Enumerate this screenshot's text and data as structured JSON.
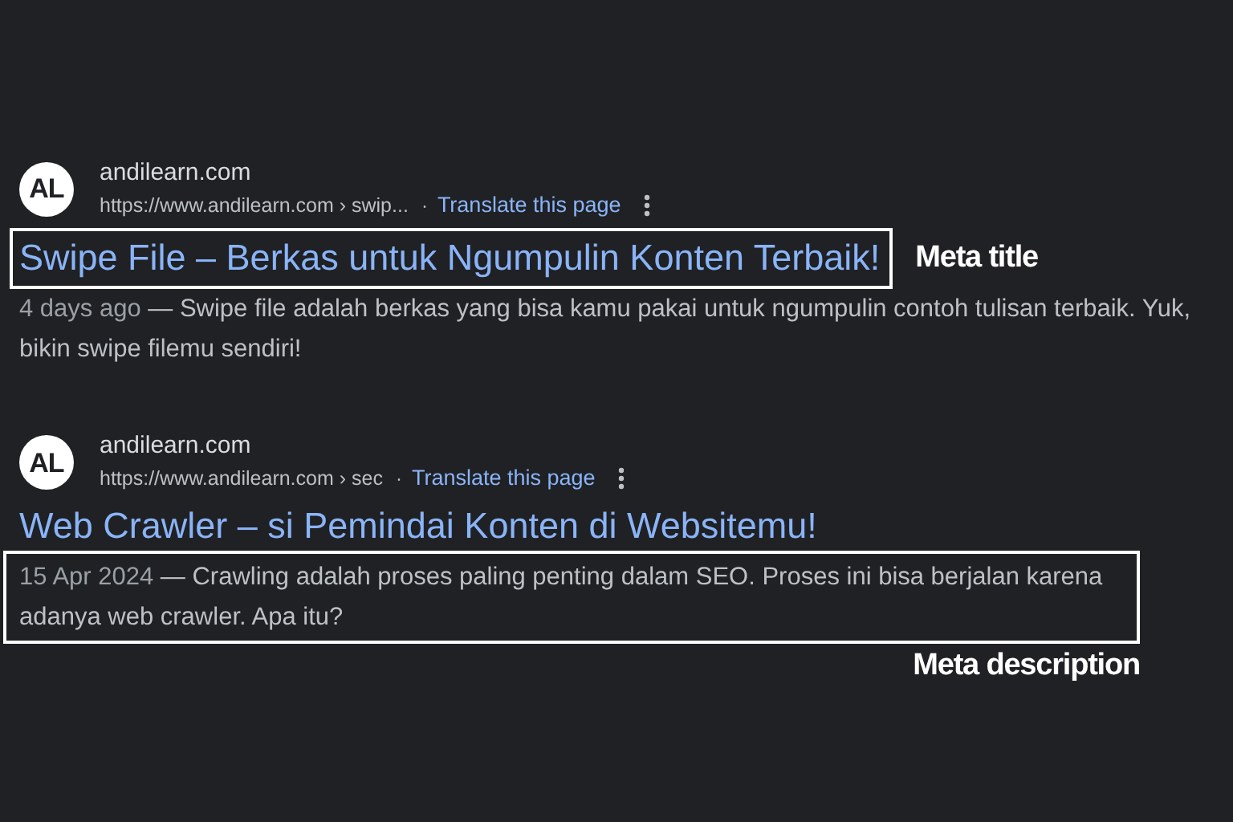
{
  "results": [
    {
      "favicon": "AL",
      "site": "andilearn.com",
      "url": "https://www.andilearn.com › swip...",
      "separator": "·",
      "translate": "Translate this page",
      "title": "Swipe File – Berkas untuk Ngumpulin Konten Terbaik!",
      "date": "4 days ago",
      "snippet": " — Swipe file adalah berkas yang bisa kamu pakai untuk ngumpulin contoh tulisan terbaik. Yuk, bikin swipe filemu sendiri!",
      "annotation": {
        "kind": "title",
        "label": "Meta title"
      }
    },
    {
      "favicon": "AL",
      "site": "andilearn.com",
      "url": "https://www.andilearn.com › sec",
      "separator": "·",
      "translate": "Translate this page",
      "title": "Web Crawler – si Pemindai Konten di Websitemu!",
      "date": "15 Apr 2024",
      "snippet": " — Crawling adalah proses paling penting dalam SEO. Proses ini bisa berjalan karena adanya web crawler. Apa itu?",
      "annotation": {
        "kind": "snippet",
        "label": "Meta description"
      }
    }
  ]
}
